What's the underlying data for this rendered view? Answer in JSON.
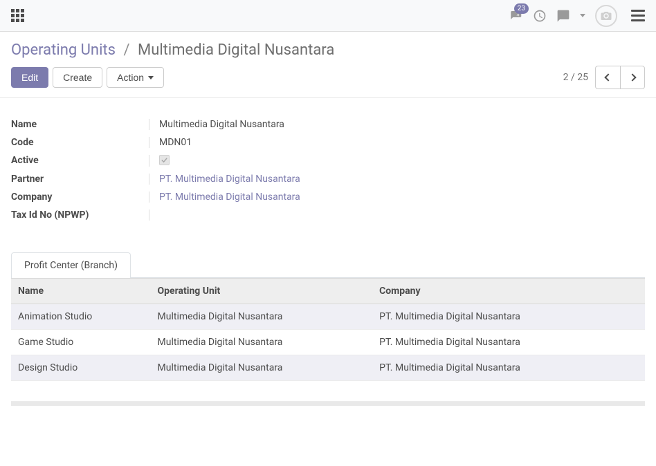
{
  "topbar": {
    "activity_badge": "23"
  },
  "breadcrumb": {
    "parent": "Operating Units",
    "sep": "/",
    "current": "Multimedia Digital Nusantara"
  },
  "buttons": {
    "edit": "Edit",
    "create": "Create",
    "action": "Action"
  },
  "pager": {
    "text": "2 / 25"
  },
  "fields": {
    "labels": {
      "name": "Name",
      "code": "Code",
      "active": "Active",
      "partner": "Partner",
      "company": "Company",
      "tax": "Tax Id No (NPWP)"
    },
    "values": {
      "name": "Multimedia Digital Nusantara",
      "code": "MDN01",
      "active": true,
      "partner": "PT. Multimedia Digital Nusantara",
      "company": "PT. Multimedia Digital Nusantara",
      "tax": ""
    }
  },
  "tabs": {
    "profit_center": "Profit Center (Branch)"
  },
  "table": {
    "headers": {
      "name": "Name",
      "ou": "Operating Unit",
      "company": "Company"
    },
    "rows": [
      {
        "name": "Animation Studio",
        "ou": "Multimedia Digital Nusantara",
        "company": "PT. Multimedia Digital Nusantara"
      },
      {
        "name": "Game Studio",
        "ou": "Multimedia Digital Nusantara",
        "company": "PT. Multimedia Digital Nusantara"
      },
      {
        "name": "Design Studio",
        "ou": "Multimedia Digital Nusantara",
        "company": "PT. Multimedia Digital Nusantara"
      }
    ]
  }
}
